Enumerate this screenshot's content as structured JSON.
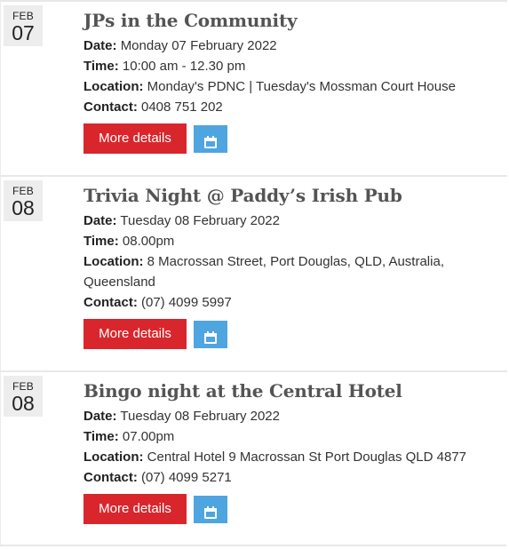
{
  "labels": {
    "date": "Date:",
    "time": "Time:",
    "location": "Location:",
    "contact": "Contact:"
  },
  "events": [
    {
      "month": "FEB",
      "day": "07",
      "title": "JPs in the Community",
      "date": "Monday 07 February 2022",
      "time": "10:00 am - 12.30 pm",
      "location": "Monday's PDNC | Tuesday's Mossman Court House",
      "contact": "0408 751 202",
      "more_label": "More details",
      "calendar_icon": "calendar-icon"
    },
    {
      "month": "FEB",
      "day": "08",
      "title": "Trivia Night @ Paddy’s Irish Pub",
      "date": "Tuesday 08 February 2022",
      "time": "08.00pm",
      "location": "8 Macrossan Street, Port Douglas, QLD, Australia, Queensland",
      "contact": "(07) 4099 5997",
      "more_label": "More details",
      "calendar_icon": "calendar-icon"
    },
    {
      "month": "FEB",
      "day": "08",
      "title": "Bingo night at the Central Hotel",
      "date": "Tuesday 08 February 2022",
      "time": "07.00pm",
      "location": "Central Hotel 9 Macrossan St Port Douglas QLD 4877",
      "contact": "(07) 4099 5271",
      "more_label": "More details",
      "calendar_icon": "calendar-icon"
    }
  ],
  "colors": {
    "primary_button": "#d9262c",
    "calendar_button": "#4ea5e0",
    "date_box": "#ededed",
    "title": "#545454"
  }
}
